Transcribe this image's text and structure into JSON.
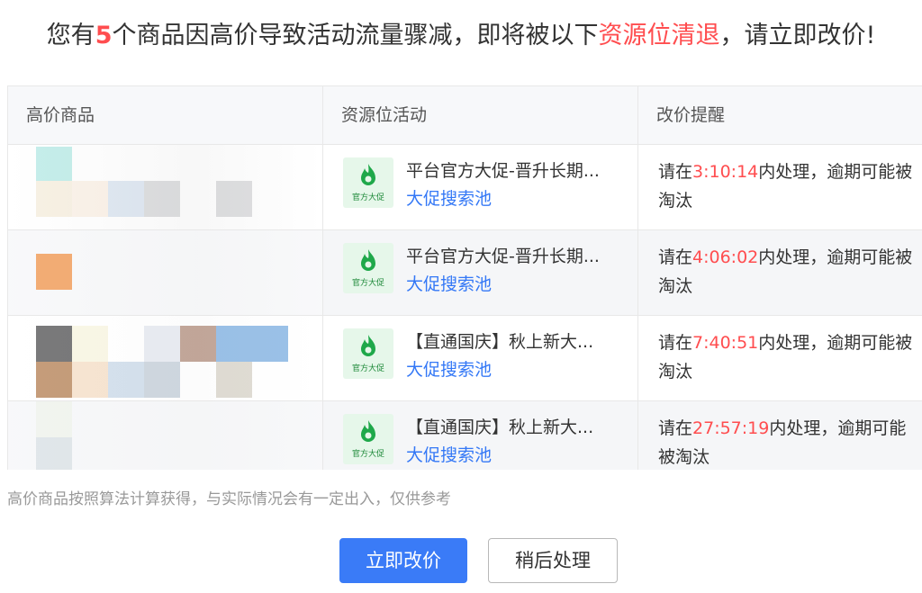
{
  "header": {
    "prefix": "您有",
    "count": "5",
    "middle": "个商品因高价导致活动流量骤减，即将被以下",
    "highlight": "资源位清退",
    "suffix": "，请立即改价!"
  },
  "table": {
    "columns": [
      "高价商品",
      "资源位活动",
      "改价提醒"
    ],
    "badge_label": "官方大促",
    "rows": [
      {
        "activity_name": "平台官方大促-晋升长期...",
        "activity_link": "大促搜索池",
        "reminder_before": "请在",
        "reminder_time": "3:10:14",
        "reminder_after": "内处理，逾期可能被",
        "reminder_tail": "淘汰"
      },
      {
        "activity_name": "平台官方大促-晋升长期...",
        "activity_link": "大促搜索池",
        "reminder_before": "请在",
        "reminder_time": "4:06:02",
        "reminder_after": "内处理，逾期可能被",
        "reminder_tail": "淘汰"
      },
      {
        "activity_name": "【直通国庆】秋上新大...",
        "activity_link": "大促搜索池",
        "reminder_before": "请在",
        "reminder_time": "7:40:51",
        "reminder_after": "内处理，逾期可能被",
        "reminder_tail": "淘汰"
      },
      {
        "activity_name": "【直通国庆】秋上新大...",
        "activity_link": "大促搜索池",
        "reminder_before": "请在",
        "reminder_time": "27:57:19",
        "reminder_after": "内处理，逾期可能",
        "reminder_tail": "被淘汰"
      }
    ]
  },
  "note": "高价商品按照算法计算获得，与实际情况会有一定出入，仅供参考",
  "buttons": {
    "primary": "立即改价",
    "secondary": "稍后处理"
  },
  "colors": {
    "accent": "#3a7bf7",
    "warning": "#ff4d4f",
    "link": "#3478f6",
    "badge_bg": "#e6f7ea"
  }
}
